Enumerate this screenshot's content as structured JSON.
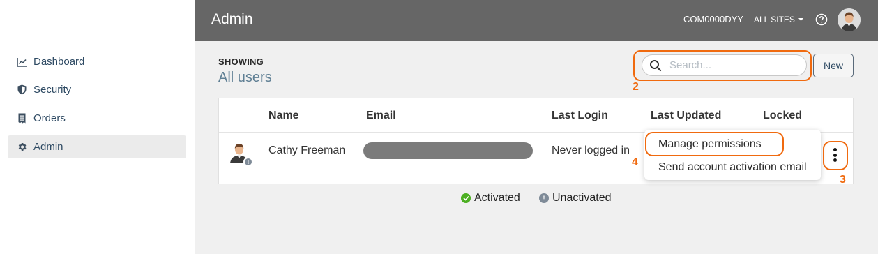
{
  "header": {
    "title": "Admin",
    "account": "COM0000DYY",
    "sites_label": "ALL SITES"
  },
  "sidebar": {
    "items": [
      {
        "label": "Dashboard",
        "icon": "chart-line-icon"
      },
      {
        "label": "Security",
        "icon": "shield-icon"
      },
      {
        "label": "Orders",
        "icon": "receipt-icon"
      },
      {
        "label": "Admin",
        "icon": "gear-icon",
        "active": true
      }
    ]
  },
  "main": {
    "showing_label": "SHOWING",
    "filter_title": "All users",
    "search_placeholder": "Search...",
    "new_button": "New"
  },
  "table": {
    "columns": [
      "Name",
      "Email",
      "Last Login",
      "Last Updated",
      "Locked"
    ],
    "rows": [
      {
        "name": "Cathy Freeman",
        "email": "",
        "last_login": "Never logged in",
        "last_updated": "",
        "locked": "",
        "status": "unactivated"
      }
    ]
  },
  "row_menu": {
    "items": [
      "Manage permissions",
      "Send account activation email"
    ]
  },
  "legend": {
    "activated": "Activated",
    "unactivated": "Unactivated"
  },
  "callouts": [
    "2",
    "3",
    "4"
  ],
  "colors": {
    "header_bg": "#666666",
    "accent_callout": "#f06a0f",
    "activated": "#4caf22",
    "unactivated": "#7f8b98",
    "nav_text": "#2e4a63"
  }
}
